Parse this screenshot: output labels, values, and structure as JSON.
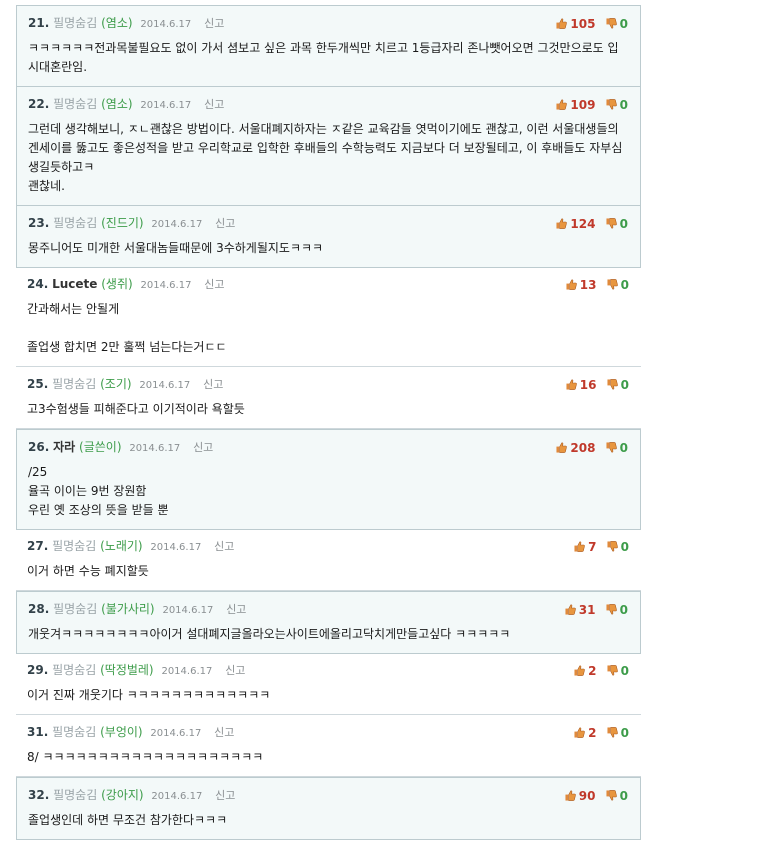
{
  "comments": [
    {
      "num": "21.",
      "author": "필명숨김",
      "named": false,
      "nick": "(염소)",
      "date": "2014.6.17",
      "report": "신고",
      "up": "105",
      "down": "0",
      "hl": true,
      "text": "ㅋㅋㅋㅋㅋㅋ전과목불필요도 없이 가서 셤보고 싶은 과목 한두개씩만 치르고 1등급자리 존나뺏어오면 그것만으로도 입시대혼란임."
    },
    {
      "num": "22.",
      "author": "필명숨김",
      "named": false,
      "nick": "(염소)",
      "date": "2014.6.17",
      "report": "신고",
      "up": "109",
      "down": "0",
      "hl": true,
      "text": "그런데 생각해보니, ㅈㄴ괜찮은 방법이다. 서울대폐지하자는 ㅈ같은 교육감들 엿먹이기에도 괜찮고, 이런 서울대생들의 겐세이를 뚫고도 좋은성적을 받고 우리학교로 입학한 후배들의 수학능력도 지금보다 더 보장될테고, 이 후배들도 자부심생길듯하고ㅋ\n괜찮네."
    },
    {
      "num": "23.",
      "author": "필명숨김",
      "named": false,
      "nick": "(진드기)",
      "date": "2014.6.17",
      "report": "신고",
      "up": "124",
      "down": "0",
      "hl": true,
      "text": "몽주니어도 미개한 서울대놈들때문에 3수하게될지도ㅋㅋㅋ"
    },
    {
      "num": "24.",
      "author": "Lucete",
      "named": true,
      "nick": "(생쥐)",
      "date": "2014.6.17",
      "report": "신고",
      "up": "13",
      "down": "0",
      "hl": false,
      "text": "간과해서는 안될게\n\n졸업생 합치면 2만 훌쩍 넘는다는거ㄷㄷ"
    },
    {
      "num": "25.",
      "author": "필명숨김",
      "named": false,
      "nick": "(조기)",
      "date": "2014.6.17",
      "report": "신고",
      "up": "16",
      "down": "0",
      "hl": false,
      "text": "고3수험생들 피해준다고 이기적이라 욕할듯"
    },
    {
      "num": "26.",
      "author": "자라",
      "named": true,
      "nick": "(글쓴이)",
      "date": "2014.6.17",
      "report": "신고",
      "up": "208",
      "down": "0",
      "hl": true,
      "text": "/25\n율곡 이이는 9번 장원함\n우린 옛 조상의 뜻을 받들 뿐"
    },
    {
      "num": "27.",
      "author": "필명숨김",
      "named": false,
      "nick": "(노래기)",
      "date": "2014.6.17",
      "report": "신고",
      "up": "7",
      "down": "0",
      "hl": false,
      "text": "이거 하면 수능 폐지할듯"
    },
    {
      "num": "28.",
      "author": "필명숨김",
      "named": false,
      "nick": "(불가사리)",
      "date": "2014.6.17",
      "report": "신고",
      "up": "31",
      "down": "0",
      "hl": true,
      "text": "개웃겨ㅋㅋㅋㅋㅋㅋㅋㅋ아이거 설대폐지글올라오는사이트에올리고닥치게만들고싶다 ㅋㅋㅋㅋㅋ"
    },
    {
      "num": "29.",
      "author": "필명숨김",
      "named": false,
      "nick": "(딱정벌레)",
      "date": "2014.6.17",
      "report": "신고",
      "up": "2",
      "down": "0",
      "hl": false,
      "text": "이거 진짜 개웃기다 ㅋㅋㅋㅋㅋㅋㅋㅋㅋㅋㅋㅋㅋ"
    },
    {
      "num": "31.",
      "author": "필명숨김",
      "named": false,
      "nick": "(부엉이)",
      "date": "2014.6.17",
      "report": "신고",
      "up": "2",
      "down": "0",
      "hl": false,
      "text": "8/ ㅋㅋㅋㅋㅋㅋㅋㅋㅋㅋㅋㅋㅋㅋㅋㅋㅋㅋㅋㅋ"
    },
    {
      "num": "32.",
      "author": "필명숨김",
      "named": false,
      "nick": "(강아지)",
      "date": "2014.6.17",
      "report": "신고",
      "up": "90",
      "down": "0",
      "hl": true,
      "text": "졸업생인데 하면 무조건 참가한다ㅋㅋㅋ"
    }
  ],
  "colors": {
    "up": "#c0392b",
    "down": "#3d9c4a",
    "nick": "#3d9c4a",
    "highlight_bg": "#f3f9f9"
  },
  "icons": {
    "up": "thumbs-up-icon",
    "down": "thumbs-down-icon"
  }
}
